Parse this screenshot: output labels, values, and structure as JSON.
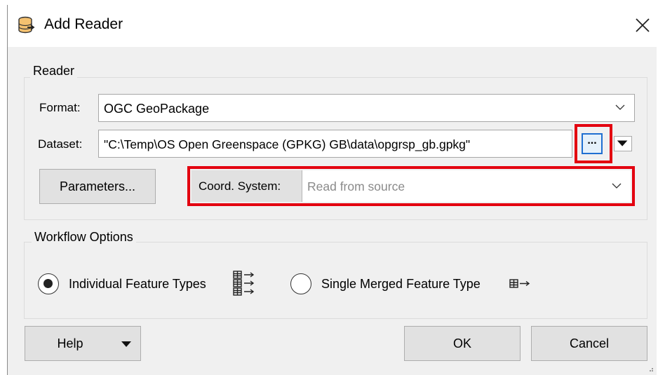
{
  "window": {
    "title": "Add Reader",
    "title_icon": "reader-db-icon",
    "close_icon": "close-icon"
  },
  "reader_group": {
    "label": "Reader",
    "format_label": "Format:",
    "format_value": "OGC GeoPackage",
    "dataset_label": "Dataset:",
    "dataset_value": "\"C:\\Temp\\OS Open Greenspace (GPKG) GB\\data\\opgrsp_gb.gpkg\"",
    "browse_label": "...",
    "parameters_label": "Parameters...",
    "coord_label": "Coord. System:",
    "coord_value": "Read from source"
  },
  "workflow_group": {
    "label": "Workflow Options",
    "options": [
      {
        "label": "Individual Feature Types",
        "selected": true,
        "icon": "individual-feature-types-icon"
      },
      {
        "label": "Single Merged Feature Type",
        "selected": false,
        "icon": "merged-feature-type-icon"
      }
    ]
  },
  "buttons": {
    "help": "Help",
    "ok": "OK",
    "cancel": "Cancel"
  },
  "colors": {
    "highlight": "#e3000f",
    "browse_border": "#1f6fd1",
    "dialog_bg": "#f0f0f0"
  }
}
